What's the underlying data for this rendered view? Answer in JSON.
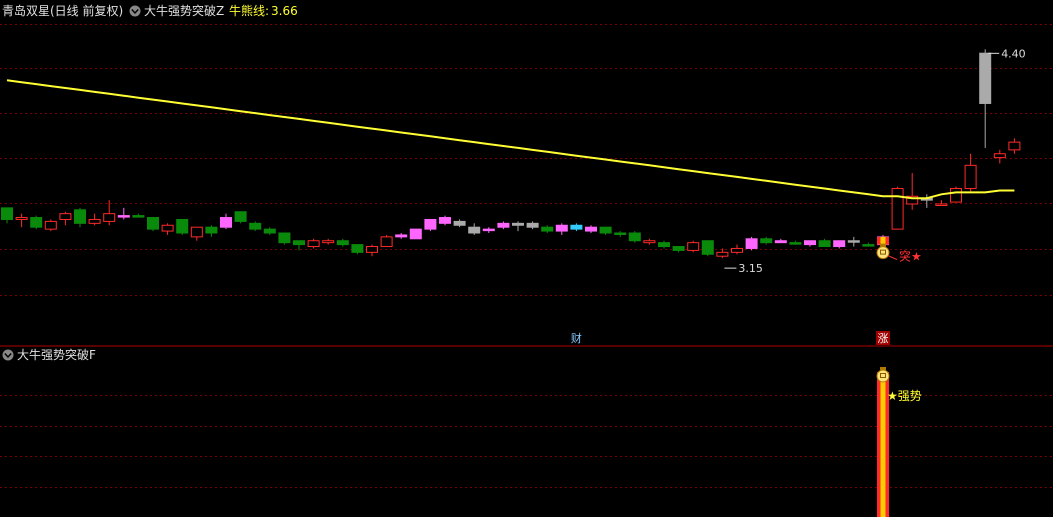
{
  "top_panel": {
    "stock_title": "青岛双星(日线 前复权)",
    "indicator_name": "大牛强势突破Z",
    "value_label": "牛熊线:",
    "value": "3.66"
  },
  "bottom_panel": {
    "indicator_name": "大牛强势突破F",
    "signal_label": "★强势"
  },
  "annotations": {
    "high_label": "4.40",
    "low_label": "3.15",
    "breakout_label": "突★",
    "cai_label": "财",
    "zhang_label": "涨"
  },
  "colors": {
    "background": "#000000",
    "up": "#ff2a2a",
    "down": "#0a8a0a",
    "magenta": "#ff66ff",
    "gray": "#aaaaaa",
    "cyan": "#33ccff",
    "bull_bear_line": "#ffff33",
    "grid": "#7a0000",
    "divider": "#b00000",
    "header_text": "#e0e0e0",
    "value_text": "#ffff33"
  },
  "chart_data": {
    "type": "candlestick",
    "price_range": [
      3.0,
      4.5
    ],
    "bull_bear_line": [
      4.24,
      4.23,
      4.22,
      4.21,
      4.2,
      4.19,
      4.18,
      4.17,
      4.16,
      4.15,
      4.14,
      4.13,
      4.12,
      4.11,
      4.1,
      4.09,
      4.08,
      4.07,
      4.06,
      4.05,
      4.04,
      4.03,
      4.02,
      4.01,
      4.0,
      3.99,
      3.98,
      3.97,
      3.96,
      3.95,
      3.94,
      3.93,
      3.92,
      3.91,
      3.9,
      3.89,
      3.88,
      3.87,
      3.86,
      3.85,
      3.84,
      3.83,
      3.82,
      3.81,
      3.8,
      3.79,
      3.78,
      3.77,
      3.76,
      3.75,
      3.74,
      3.73,
      3.72,
      3.71,
      3.7,
      3.69,
      3.68,
      3.67,
      3.66,
      3.65,
      3.64,
      3.64,
      3.63,
      3.63,
      3.65,
      3.66,
      3.66,
      3.66,
      3.67,
      3.67
    ],
    "candles": [
      {
        "o": 3.52,
        "c": 3.58,
        "h": 3.58,
        "l": 3.5,
        "k": "down"
      },
      {
        "o": 3.52,
        "c": 3.53,
        "h": 3.55,
        "l": 3.48,
        "k": "up"
      },
      {
        "o": 3.53,
        "c": 3.48,
        "h": 3.54,
        "l": 3.47,
        "k": "down"
      },
      {
        "o": 3.47,
        "c": 3.51,
        "h": 3.52,
        "l": 3.46,
        "k": "up"
      },
      {
        "o": 3.52,
        "c": 3.55,
        "h": 3.56,
        "l": 3.49,
        "k": "up"
      },
      {
        "o": 3.57,
        "c": 3.5,
        "h": 3.58,
        "l": 3.48,
        "k": "down"
      },
      {
        "o": 3.5,
        "c": 3.52,
        "h": 3.55,
        "l": 3.49,
        "k": "up"
      },
      {
        "o": 3.51,
        "c": 3.55,
        "h": 3.62,
        "l": 3.49,
        "k": "up"
      },
      {
        "o": 3.54,
        "c": 3.54,
        "h": 3.58,
        "l": 3.52,
        "k": "magenta"
      },
      {
        "o": 3.54,
        "c": 3.54,
        "h": 3.55,
        "l": 3.53,
        "k": "down"
      },
      {
        "o": 3.53,
        "c": 3.47,
        "h": 3.53,
        "l": 3.46,
        "k": "down"
      },
      {
        "o": 3.46,
        "c": 3.49,
        "h": 3.5,
        "l": 3.44,
        "k": "up"
      },
      {
        "o": 3.52,
        "c": 3.45,
        "h": 3.52,
        "l": 3.44,
        "k": "down"
      },
      {
        "o": 3.43,
        "c": 3.48,
        "h": 3.48,
        "l": 3.41,
        "k": "up"
      },
      {
        "o": 3.48,
        "c": 3.45,
        "h": 3.49,
        "l": 3.43,
        "k": "down"
      },
      {
        "o": 3.48,
        "c": 3.53,
        "h": 3.55,
        "l": 3.47,
        "k": "magenta"
      },
      {
        "o": 3.56,
        "c": 3.51,
        "h": 3.56,
        "l": 3.5,
        "k": "down"
      },
      {
        "o": 3.5,
        "c": 3.47,
        "h": 3.51,
        "l": 3.46,
        "k": "down"
      },
      {
        "o": 3.47,
        "c": 3.45,
        "h": 3.48,
        "l": 3.44,
        "k": "down"
      },
      {
        "o": 3.45,
        "c": 3.4,
        "h": 3.45,
        "l": 3.39,
        "k": "down"
      },
      {
        "o": 3.41,
        "c": 3.39,
        "h": 3.41,
        "l": 3.36,
        "k": "down"
      },
      {
        "o": 3.38,
        "c": 3.41,
        "h": 3.42,
        "l": 3.37,
        "k": "up"
      },
      {
        "o": 3.4,
        "c": 3.41,
        "h": 3.42,
        "l": 3.39,
        "k": "up"
      },
      {
        "o": 3.41,
        "c": 3.39,
        "h": 3.42,
        "l": 3.38,
        "k": "down"
      },
      {
        "o": 3.39,
        "c": 3.35,
        "h": 3.39,
        "l": 3.34,
        "k": "down"
      },
      {
        "o": 3.35,
        "c": 3.38,
        "h": 3.39,
        "l": 3.33,
        "k": "up"
      },
      {
        "o": 3.38,
        "c": 3.43,
        "h": 3.44,
        "l": 3.38,
        "k": "up"
      },
      {
        "o": 3.43,
        "c": 3.44,
        "h": 3.45,
        "l": 3.42,
        "k": "magenta"
      },
      {
        "o": 3.42,
        "c": 3.47,
        "h": 3.47,
        "l": 3.42,
        "k": "magenta"
      },
      {
        "o": 3.47,
        "c": 3.52,
        "h": 3.52,
        "l": 3.46,
        "k": "magenta"
      },
      {
        "o": 3.5,
        "c": 3.53,
        "h": 3.54,
        "l": 3.49,
        "k": "magenta"
      },
      {
        "o": 3.51,
        "c": 3.49,
        "h": 3.52,
        "l": 3.48,
        "k": "gray"
      },
      {
        "o": 3.48,
        "c": 3.45,
        "h": 3.5,
        "l": 3.44,
        "k": "gray"
      },
      {
        "o": 3.47,
        "c": 3.47,
        "h": 3.48,
        "l": 3.45,
        "k": "magenta"
      },
      {
        "o": 3.48,
        "c": 3.5,
        "h": 3.51,
        "l": 3.47,
        "k": "magenta"
      },
      {
        "o": 3.5,
        "c": 3.49,
        "h": 3.51,
        "l": 3.46,
        "k": "gray"
      },
      {
        "o": 3.5,
        "c": 3.48,
        "h": 3.51,
        "l": 3.47,
        "k": "gray"
      },
      {
        "o": 3.48,
        "c": 3.46,
        "h": 3.49,
        "l": 3.45,
        "k": "down"
      },
      {
        "o": 3.46,
        "c": 3.49,
        "h": 3.5,
        "l": 3.44,
        "k": "magenta"
      },
      {
        "o": 3.49,
        "c": 3.47,
        "h": 3.5,
        "l": 3.46,
        "k": "cyan"
      },
      {
        "o": 3.46,
        "c": 3.48,
        "h": 3.49,
        "l": 3.45,
        "k": "magenta"
      },
      {
        "o": 3.48,
        "c": 3.45,
        "h": 3.48,
        "l": 3.44,
        "k": "down"
      },
      {
        "o": 3.45,
        "c": 3.45,
        "h": 3.46,
        "l": 3.43,
        "k": "down"
      },
      {
        "o": 3.45,
        "c": 3.41,
        "h": 3.46,
        "l": 3.4,
        "k": "down"
      },
      {
        "o": 3.4,
        "c": 3.41,
        "h": 3.42,
        "l": 3.39,
        "k": "up"
      },
      {
        "o": 3.4,
        "c": 3.38,
        "h": 3.41,
        "l": 3.37,
        "k": "down"
      },
      {
        "o": 3.38,
        "c": 3.36,
        "h": 3.38,
        "l": 3.35,
        "k": "down"
      },
      {
        "o": 3.36,
        "c": 3.4,
        "h": 3.41,
        "l": 3.35,
        "k": "up"
      },
      {
        "o": 3.41,
        "c": 3.34,
        "h": 3.41,
        "l": 3.33,
        "k": "down"
      },
      {
        "o": 3.33,
        "c": 3.35,
        "h": 3.37,
        "l": 3.32,
        "k": "up"
      },
      {
        "o": 3.35,
        "c": 3.37,
        "h": 3.39,
        "l": 3.34,
        "k": "up"
      },
      {
        "o": 3.37,
        "c": 3.42,
        "h": 3.43,
        "l": 3.36,
        "k": "magenta"
      },
      {
        "o": 3.42,
        "c": 3.4,
        "h": 3.43,
        "l": 3.39,
        "k": "down"
      },
      {
        "o": 3.4,
        "c": 3.41,
        "h": 3.42,
        "l": 3.4,
        "k": "magenta"
      },
      {
        "o": 3.4,
        "c": 3.4,
        "h": 3.41,
        "l": 3.39,
        "k": "down"
      },
      {
        "o": 3.39,
        "c": 3.41,
        "h": 3.41,
        "l": 3.38,
        "k": "magenta"
      },
      {
        "o": 3.41,
        "c": 3.38,
        "h": 3.42,
        "l": 3.38,
        "k": "down"
      },
      {
        "o": 3.38,
        "c": 3.41,
        "h": 3.41,
        "l": 3.37,
        "k": "magenta"
      },
      {
        "o": 3.41,
        "c": 3.41,
        "h": 3.43,
        "l": 3.38,
        "k": "gray"
      },
      {
        "o": 3.39,
        "c": 3.39,
        "h": 3.4,
        "l": 3.38,
        "k": "down"
      },
      {
        "o": 3.39,
        "c": 3.43,
        "h": 3.44,
        "l": 3.39,
        "k": "magenta"
      },
      {
        "o": 3.47,
        "c": 3.68,
        "h": 3.69,
        "l": 3.47,
        "k": "up"
      },
      {
        "o": 3.64,
        "c": 3.6,
        "h": 3.76,
        "l": 3.57,
        "k": "up"
      },
      {
        "o": 3.62,
        "c": 3.63,
        "h": 3.65,
        "l": 3.58,
        "k": "gray"
      },
      {
        "o": 3.6,
        "c": 3.6,
        "h": 3.62,
        "l": 3.59,
        "k": "up"
      },
      {
        "o": 3.61,
        "c": 3.68,
        "h": 3.69,
        "l": 3.61,
        "k": "up"
      },
      {
        "o": 3.68,
        "c": 3.8,
        "h": 3.86,
        "l": 3.66,
        "k": "up"
      },
      {
        "o": 4.12,
        "c": 4.38,
        "h": 4.4,
        "l": 3.89,
        "k": "gray"
      },
      {
        "o": 3.84,
        "c": 3.86,
        "h": 3.88,
        "l": 3.81,
        "k": "up"
      },
      {
        "o": 3.88,
        "c": 3.92,
        "h": 3.94,
        "l": 3.86,
        "k": "up"
      }
    ],
    "breakout_index": 60,
    "cai_index": 39,
    "zhang_index": 60,
    "strength_bar_index": 60
  }
}
